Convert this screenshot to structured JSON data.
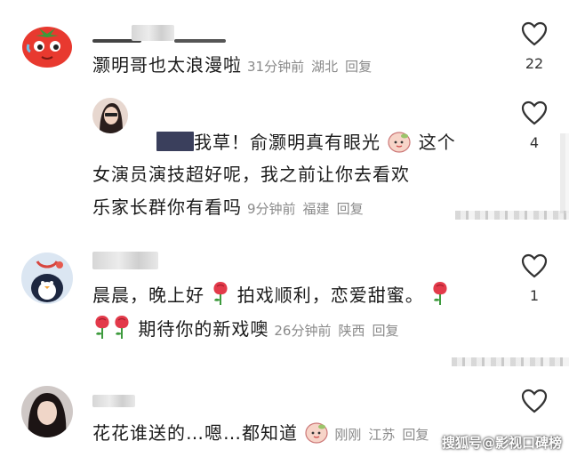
{
  "comments": [
    {
      "text": "灏明哥也太浪漫啦",
      "time": "31分钟前",
      "location": "湖北",
      "reply": "回复",
      "likes": "22"
    },
    {
      "text_line1_a": "我草！俞灏明真有眼光",
      "text_line1_b": "这个",
      "text_line2": "女演员演技超好呢，我之前让你去看欢",
      "text_line3": "乐家长群你有看吗",
      "time": "9分钟前",
      "location": "福建",
      "reply": "回复",
      "likes": "4"
    },
    {
      "text_line1_a": "晨晨，晚上好",
      "text_line1_b": "拍戏顺利，恋爱甜蜜。",
      "text_line2": "期待你的新戏噢",
      "time": "26分钟前",
      "location": "陕西",
      "reply": "回复",
      "likes": "1"
    },
    {
      "text": "花花谁送的…嗯…都知道",
      "time": "刚刚",
      "location": "江苏",
      "reply": "回复"
    }
  ],
  "watermark": "搜狐号@影视口碑榜",
  "colors": {
    "heart_stroke": "#333333",
    "meta": "#8a8a8a",
    "text": "#1b1b1b"
  },
  "icons": [
    "heart-outline-icon",
    "rose-emoji-icon",
    "peach-emoji-icon"
  ]
}
